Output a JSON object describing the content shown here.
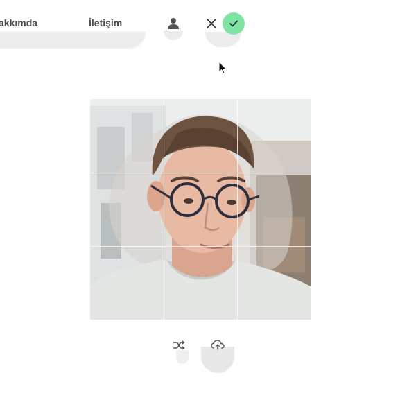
{
  "nav": {
    "about_label": "akkımda",
    "contact_label": "İletişim"
  },
  "icons": {
    "user": "user-icon",
    "close": "close-icon",
    "confirm": "check-icon",
    "shuffle": "shuffle-icon",
    "upload": "cloud-upload-icon",
    "cursor": "cursor-icon"
  },
  "colors": {
    "confirm_accent": "#7fe3a3",
    "text": "#4a4a4a",
    "icon": "#555555"
  },
  "editor": {
    "photo_alt": "Portrait photo of a young man with glasses",
    "grid_rows": 3,
    "grid_cols": 3
  }
}
